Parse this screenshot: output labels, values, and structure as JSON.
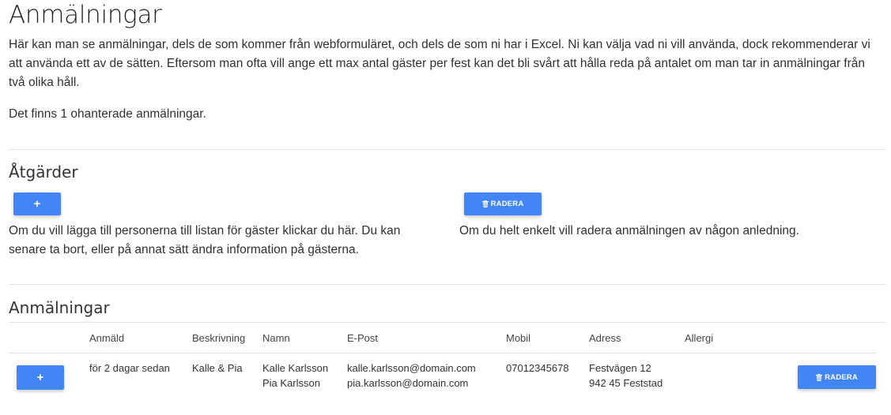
{
  "page": {
    "title": "Anmälningar",
    "intro": "Här kan man se anmälningar, dels de som kommer från webformuläret, och dels de som ni har i Excel. Ni kan välja vad ni vill använda, dock rekommenderar vi att använda ett av de sätten. Eftersom man ofta vill ange ett max antal gäster per fest kan det bli svårt att hålla reda på antalet om man tar in anmälningar från två olika håll.",
    "count_text": "Det finns 1 ohanterade anmälningar."
  },
  "actions": {
    "heading": "Åtgärder",
    "add_label": "+",
    "add_desc": "Om du vill lägga till personerna till listan för gäster klickar du här. Du kan senare ta bort, eller på annat sätt ändra information på gästerna.",
    "delete_label": "RADERA",
    "delete_desc": "Om du helt enkelt vill radera anmälningen av någon anledning."
  },
  "list": {
    "heading": "Anmälningar",
    "columns": [
      "Anmäld",
      "Beskrivning",
      "Namn",
      "E-Post",
      "Mobil",
      "Adress",
      "Allergi"
    ],
    "rows": [
      {
        "add_label": "+",
        "registered": "för 2 dagar sedan",
        "description": "Kalle & Pia",
        "names": [
          "Kalle Karlsson",
          "Pia Karlsson"
        ],
        "emails": [
          "kalle.karlsson@domain.com",
          "pia.karlsson@domain.com"
        ],
        "mobile": "07012345678",
        "address": [
          "Festvägen 12",
          "942 45 Feststad"
        ],
        "allergy": "",
        "delete_label": "RADERA"
      }
    ]
  },
  "colors": {
    "primary": "#4285f4"
  },
  "icons": {
    "add": "plus-icon",
    "delete": "trash-icon"
  }
}
